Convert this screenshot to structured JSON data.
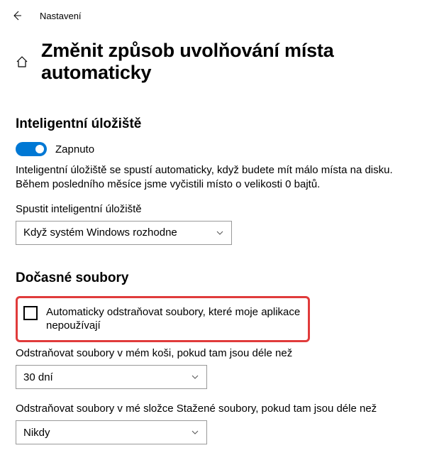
{
  "titlebar": {
    "app_name": "Nastavení"
  },
  "header": {
    "page_title": "Změnit způsob uvolňování místa automaticky"
  },
  "storage_sense": {
    "section_title": "Inteligentní úložiště",
    "toggle_state": "Zapnuto",
    "description": "Inteligentní úložiště se spustí automaticky, když budete mít málo místa na disku. Během posledního měsíce jsme vyčistili místo o velikosti 0 bajtů.",
    "run_label": "Spustit inteligentní úložiště",
    "run_value": "Když systém Windows rozhodne"
  },
  "temp_files": {
    "section_title": "Dočasné soubory",
    "checkbox_label": "Automaticky odstraňovat soubory, které moje aplikace nepoužívají",
    "recycle_label": "Odstraňovat soubory v mém koši, pokud tam jsou déle než",
    "recycle_value": "30 dní",
    "downloads_label": "Odstraňovat soubory v mé složce Stažené soubory, pokud tam jsou déle než",
    "downloads_value": "Nikdy"
  }
}
